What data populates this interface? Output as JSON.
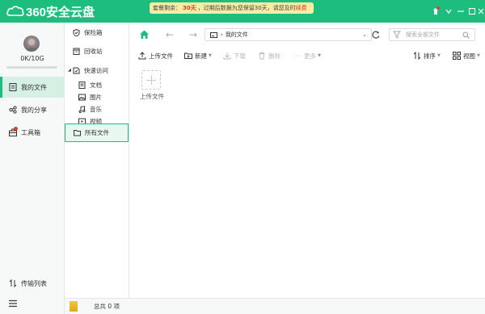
{
  "app": {
    "logo_text": "360安全云盘"
  },
  "notice": {
    "prefix": "套餐剩余：",
    "days": "30天",
    "middle": "，过期后数据为您保留30天，请您及时",
    "link": "续费"
  },
  "window_controls": {
    "skin": "skin-icon",
    "menu": "chevron-down-icon",
    "minimize": "minimize-icon",
    "maximize": "maximize-icon",
    "close": "close-icon"
  },
  "user": {
    "quota": "0K/10G",
    "quota_fraction": 0.0
  },
  "leftnav": {
    "items": [
      {
        "label": "我的文件",
        "icon": "file-icon",
        "active": true
      },
      {
        "label": "我的分享",
        "icon": "share-icon",
        "active": false
      },
      {
        "label": "工具箱",
        "icon": "toolbox-icon",
        "active": false,
        "badge_dot": true
      }
    ],
    "transfer_label": "传输列表"
  },
  "tree": {
    "safe_box": "保险箱",
    "recycle_bin": "回收站",
    "quick_access": "快速访问",
    "quick_items": [
      "文档",
      "图片",
      "音乐",
      "视频"
    ],
    "all_files": "所有文件"
  },
  "toolbar": {
    "path": "我的文件",
    "search_placeholder": "搜索全部文件",
    "upload": "上传文件",
    "new": "新建",
    "download": "下载",
    "delete": "删除",
    "more": "更多",
    "sort": "排序",
    "view": "视图"
  },
  "content": {
    "upload_tile_label": "上传文件"
  },
  "status": {
    "count_text": "总共 0 项"
  },
  "colors": {
    "brand": "#1dbd7e",
    "notice_bg": "#f5eda5",
    "alert": "#e53935"
  }
}
